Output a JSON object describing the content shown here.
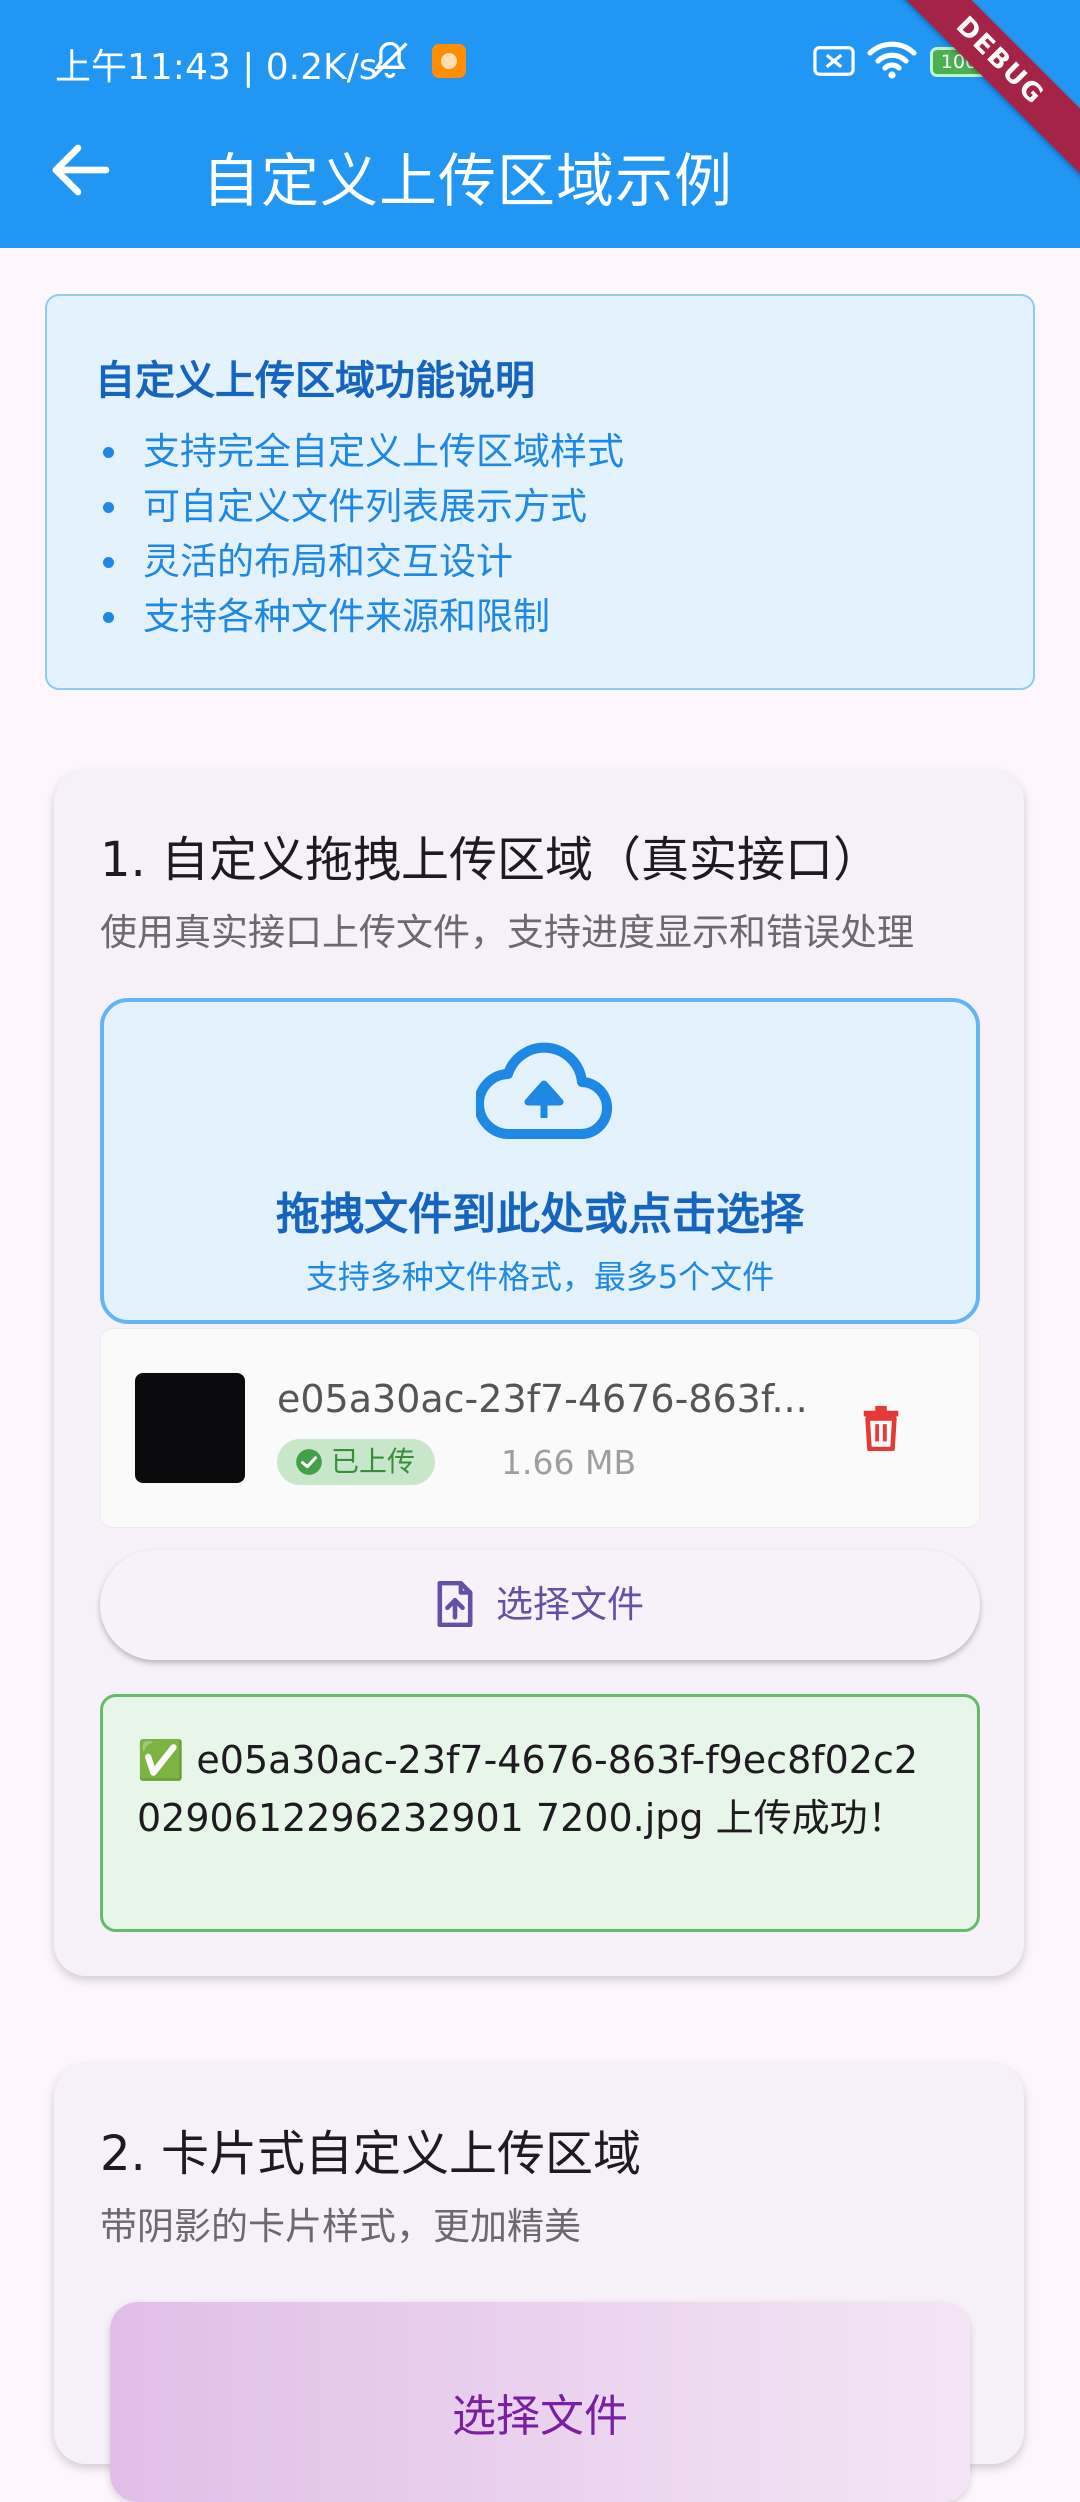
{
  "status_bar": {
    "time": "上午11:43 | 0.2K/s",
    "battery": "100"
  },
  "app_bar": {
    "title": "自定义上传区域示例",
    "debug_label": "DEBUG"
  },
  "info": {
    "title": "自定义上传区域功能说明",
    "items": [
      "支持完全自定义上传区域样式",
      "可自定义文件列表展示方式",
      "灵活的布局和交互设计",
      "支持各种文件来源和限制"
    ]
  },
  "section1": {
    "title": "1. 自定义拖拽上传区域（真实接口）",
    "description": "使用真实接口上传文件，支持进度显示和错误处理",
    "dropzone": {
      "title": "拖拽文件到此处或点击选择",
      "hint": "支持多种文件格式，最多5个文件"
    },
    "file": {
      "name": "e05a30ac-23f7-4676-863f...",
      "status": "已上传",
      "size": "1.66 MB"
    },
    "select_button": "选择文件",
    "success_message": "✅ e05a30ac-23f7-4676-863f-f9ec8f02c20290612296232901 7200.jpg 上传成功！"
  },
  "section2": {
    "title": "2. 卡片式自定义上传区域",
    "description": "带阴影的卡片样式，更加精美",
    "preview_label": "选择文件"
  },
  "colors": {
    "app_bar": "#2196f3",
    "info_bg": "#e3f2fd",
    "success_bg": "#e8f5e9",
    "delete": "#e53935",
    "button_text": "#6750a4"
  }
}
